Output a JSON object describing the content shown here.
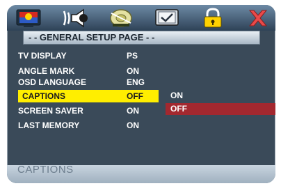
{
  "title": "- - GENERAL SETUP PAGE - -",
  "toolbar": {
    "icons": [
      "general-setup-icon",
      "audio-speaker-icon",
      "video-disc-icon",
      "preference-monitor-icon",
      "lock-icon",
      "exit-icon"
    ]
  },
  "menu": {
    "items": [
      {
        "label": "TV DISPLAY",
        "value": "PS"
      },
      {
        "label": "ANGLE MARK",
        "value": "ON"
      },
      {
        "label": "OSD LANGUAGE",
        "value": "ENG"
      },
      {
        "label": "CAPTIONS",
        "value": "OFF"
      },
      {
        "label": "SCREEN SAVER",
        "value": "ON"
      },
      {
        "label": "LAST MEMORY",
        "value": "ON"
      }
    ],
    "selected": "CAPTIONS"
  },
  "submenu": {
    "options": [
      "ON",
      "OFF"
    ],
    "selected": "OFF"
  },
  "status_bar": {
    "text": "CAPTIONS"
  },
  "colors": {
    "highlight": "#ffee00",
    "submenu_selected": "#a3282f",
    "panel": "#3a4a59"
  }
}
